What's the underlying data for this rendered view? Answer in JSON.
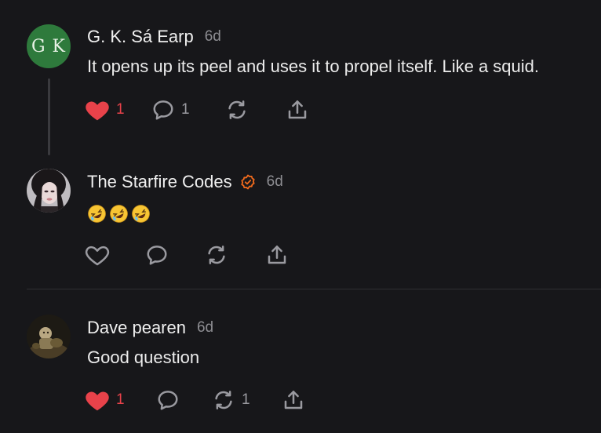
{
  "comments": [
    {
      "avatar_initials": "G K",
      "avatar_color": "#2e7a3c",
      "author": "G. K. Sá Earp",
      "time": "6d",
      "text": "It opens up its peel and uses it to propel itself. Like a squid.",
      "liked": true,
      "like_count": "1",
      "reply_count": "1",
      "restack_count": ""
    },
    {
      "author": "The Starfire Codes",
      "verified": true,
      "time": "6d",
      "emoji": [
        "rolling-on-floor-laughing",
        "rolling-on-floor-laughing",
        "rolling-on-floor-laughing"
      ],
      "liked": false,
      "like_count": "",
      "reply_count": "",
      "restack_count": ""
    },
    {
      "author": "Dave pearen",
      "time": "6d",
      "text": "Good question",
      "liked": true,
      "like_count": "1",
      "reply_count": "",
      "restack_count": "1"
    }
  ],
  "colors": {
    "background": "#17171a",
    "like_red": "#e8424a",
    "icon_grey": "#9a9aa0",
    "verified_orange": "#f26b1d"
  }
}
